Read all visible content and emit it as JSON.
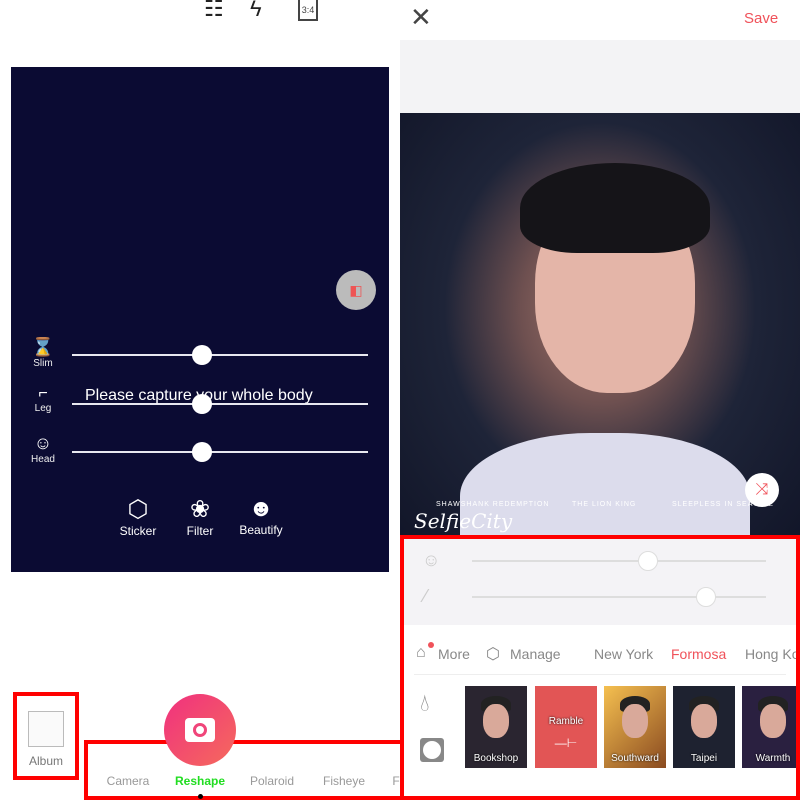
{
  "camera": {
    "top_icons": [
      "sliders-icon",
      "flash-off-icon"
    ],
    "aspect_ratio": "3:4",
    "overlay_text": "Please capture your whole body",
    "sliders": [
      {
        "label": "Slim",
        "icon": "waist-icon",
        "value": 0.44
      },
      {
        "label": "Leg",
        "icon": "high-heel-icon",
        "value": 0.44
      },
      {
        "label": "Head",
        "icon": "face-icon",
        "value": 0.44
      }
    ],
    "tools": [
      {
        "label": "Sticker",
        "icon": "sticker-icon"
      },
      {
        "label": "Filter",
        "icon": "filter-icon"
      },
      {
        "label": "Beautify",
        "icon": "beautify-icon"
      }
    ],
    "album_label": "Album",
    "modes": [
      "Camera",
      "Reshape",
      "Polaroid",
      "Fisheye",
      "F"
    ],
    "active_mode": "Reshape",
    "active_color": "#22dd22",
    "shutter_color": "#f0457a"
  },
  "editor": {
    "save_label": "Save",
    "accent": "#f0525a",
    "photo_caption": {
      "brand": "SelfieCity",
      "titles": [
        "SHAWSHANK REDEMPTION",
        "THE LION KING",
        "SLEEPLESS IN SEATTLE"
      ]
    },
    "sliders": [
      {
        "icon": "face-smooth-icon",
        "value": 0.6
      },
      {
        "icon": "magic-wand-icon",
        "value": 0.8
      }
    ],
    "tabs": [
      {
        "label": "More",
        "icon": "store-icon"
      },
      {
        "label": "Manage",
        "icon": "cube-icon"
      },
      {
        "label": "New York"
      },
      {
        "label": "Formosa",
        "active": true
      },
      {
        "label": "Hong Kong"
      }
    ],
    "filters": [
      {
        "label": "Bookshop"
      },
      {
        "label": "Ramble",
        "selected": true
      },
      {
        "label": "Southward"
      },
      {
        "label": "Taipei"
      },
      {
        "label": "Warmth"
      }
    ]
  }
}
